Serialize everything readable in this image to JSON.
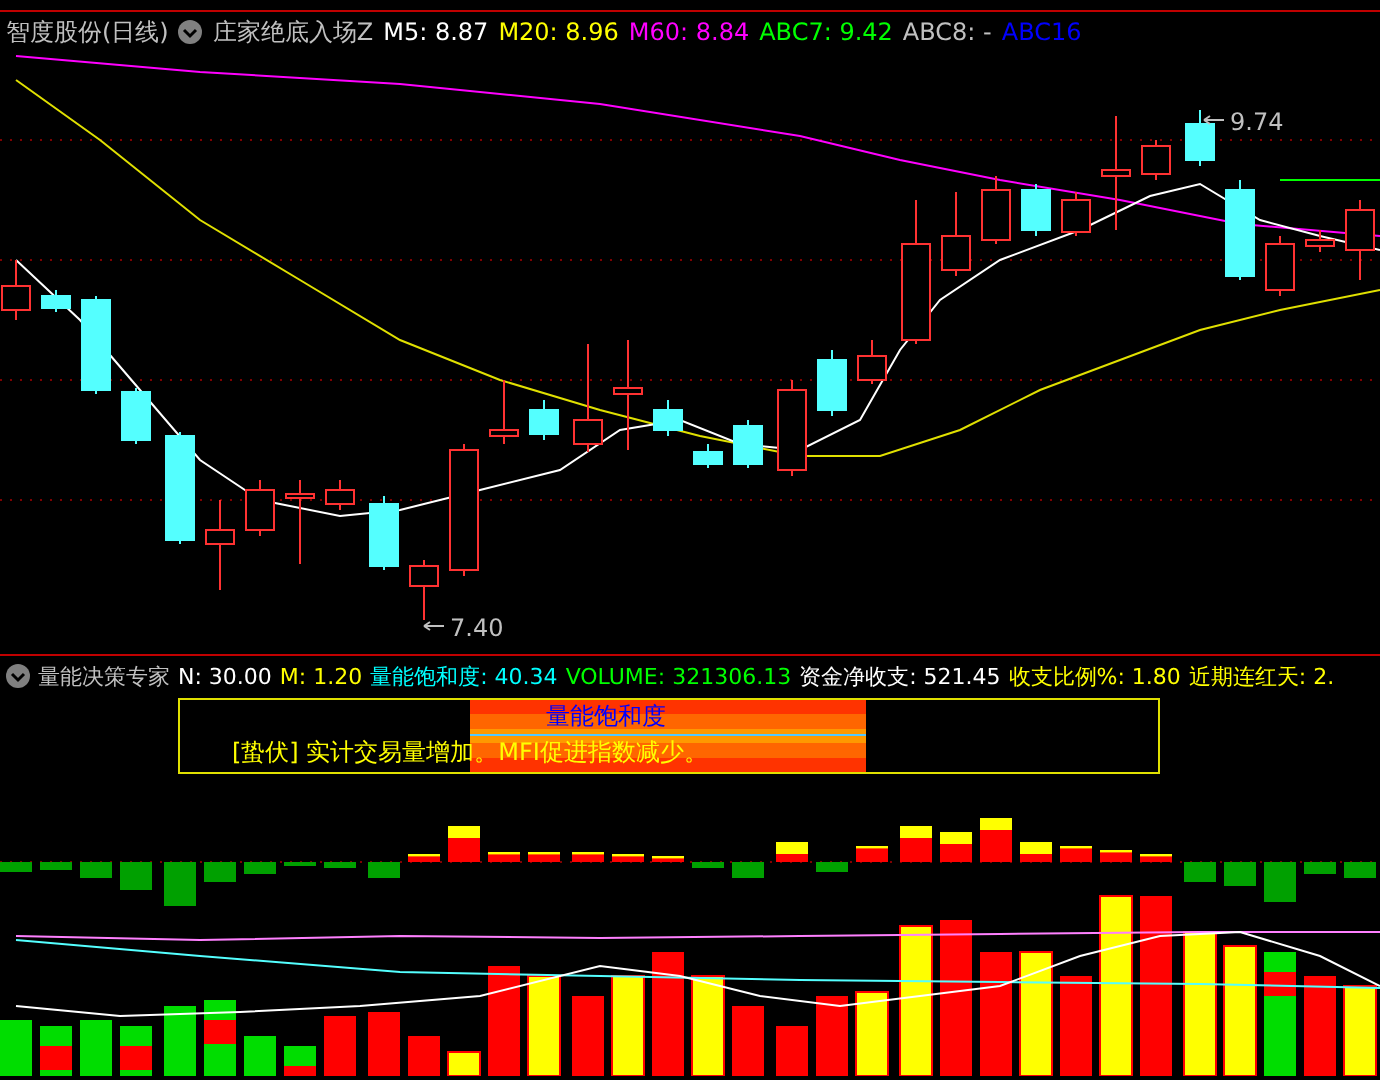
{
  "price_panel": {
    "title": "智度股份(日线)",
    "indicator": "庄家绝底入场Z",
    "legend": [
      {
        "text": "M5: 8.87",
        "color": "#ffffff"
      },
      {
        "text": "M20: 8.96",
        "color": "#ffff00"
      },
      {
        "text": "M60: 8.84",
        "color": "#ff00ff"
      },
      {
        "text": "ABC7: 9.42",
        "color": "#00ff00"
      },
      {
        "text": "ABC8: -",
        "color": "#c0c0c0"
      },
      {
        "text": "ABC16",
        "color": "#0000ff"
      }
    ],
    "high_label": "9.74",
    "low_label": "7.40"
  },
  "volume_panel": {
    "title": "量能决策专家",
    "legend": [
      {
        "text": "N: 30.00",
        "color": "#ffffff"
      },
      {
        "text": "M: 1.20",
        "color": "#ffff00"
      },
      {
        "text": "量能饱和度: 40.34",
        "color": "#00ffff"
      },
      {
        "text": "VOLUME: 321306.13",
        "color": "#00ff00"
      },
      {
        "text": "资金净收支: 521.45",
        "color": "#ffffff"
      },
      {
        "text": "收支比例%: 1.80",
        "color": "#ffff00"
      },
      {
        "text": "近期连红天: 2.",
        "color": "#ffff00"
      }
    ],
    "box_title": "量能饱和度",
    "box_message": "[蛰伏] 实计交易量增加。MFI促进指数减少。"
  }
}
